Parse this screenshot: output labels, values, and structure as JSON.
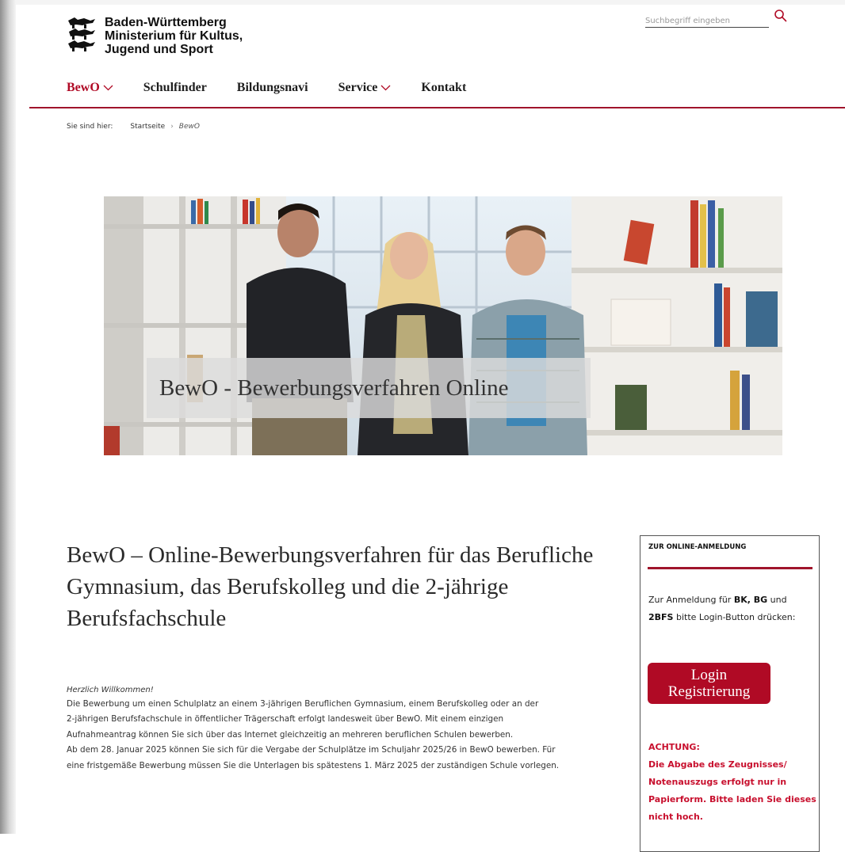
{
  "header": {
    "logo_lines": [
      "Baden-Württemberg",
      "Ministerium für Kultus,",
      "Jugend und Sport"
    ],
    "search_placeholder": "Suchbegriff eingeben"
  },
  "nav": {
    "items": [
      {
        "label": "BewO",
        "dropdown": true
      },
      {
        "label": "Schulfinder",
        "dropdown": false
      },
      {
        "label": "Bildungsnavi",
        "dropdown": false
      },
      {
        "label": "Service",
        "dropdown": true
      },
      {
        "label": "Kontakt",
        "dropdown": false
      }
    ]
  },
  "breadcrumb": {
    "prefix": "Sie sind hier:",
    "home": "Startseite",
    "separator": "›",
    "current": "BewO"
  },
  "hero": {
    "caption": "BewO - Bewerbungsverfahren Online"
  },
  "main": {
    "title": "BewO – Online-Bewerbungsverfahren für das Berufliche Gymnasium, das Berufskolleg und die 2-jährige Berufsfachschule",
    "welcome": "Herzlich Willkommen!",
    "paragraph_lines": [
      "Die Bewerbung um einen Schulplatz an einem 3-jährigen Beruflichen Gymnasium, einem Berufskolleg oder an der",
      "2-jährigen Berufsfachschule in öffentlicher Trägerschaft erfolgt landesweit über BewO. Mit einem einzigen",
      "Aufnahmeantrag können Sie sich über das Internet gleichzeitig an mehreren beruflichen Schulen bewerben.",
      "Ab dem 28. Januar 2025 können Sie sich für die Vergabe der Schulplätze im Schuljahr 2025/26 in BewO bewerben. Für",
      "eine fristgemäße Bewerbung müssen Sie die Unterlagen bis spätestens 1. März 2025 der zuständigen Schule vorlegen."
    ]
  },
  "sidebar": {
    "title": "ZUR ONLINE-ANMELDUNG",
    "text_pre": "Zur Anmeldung für ",
    "bk": "BK, BG",
    "text_und": " und",
    "bfs": "2BFS",
    "text_post": " bitte Login-Button drücken:",
    "login_line1": "Login",
    "login_line2": "Registrierung",
    "warning_title": "ACHTUNG:",
    "warning_text": "Die Abgabe des Zeugnisses/ Notenauszugs erfolgt nur in Papierform. Bitte laden Sie dieses nicht hoch."
  },
  "colors": {
    "accent": "#b00a25",
    "warning": "#c8102e"
  }
}
